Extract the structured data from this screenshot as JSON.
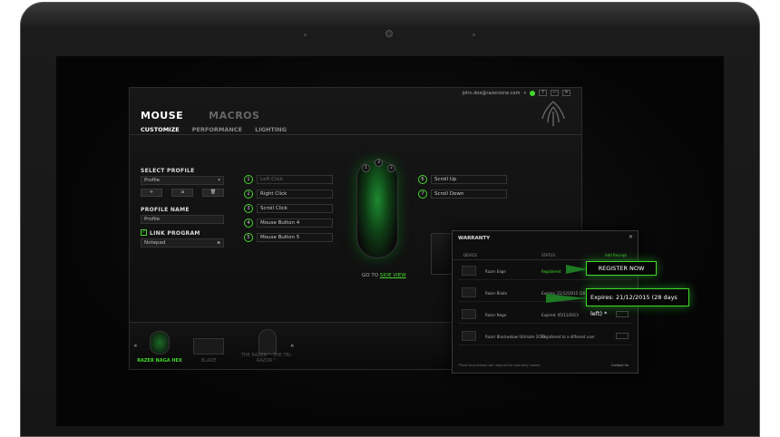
{
  "app": {
    "user": "john.doe@razerzone.com",
    "window_buttons": [
      "?",
      "—",
      "✕"
    ],
    "nav_main": [
      "MOUSE",
      "MACROS"
    ],
    "nav_sub": [
      "CUSTOMIZE",
      "PERFORMANCE",
      "LIGHTING"
    ]
  },
  "profile": {
    "select_label": "SELECT PROFILE",
    "selected": "Profile",
    "buttons": [
      "+",
      "⇲",
      "🗑"
    ],
    "name_label": "PROFILE NAME",
    "name_value": "Profile",
    "link_label": "LINK PROGRAM",
    "link_value": "Notepad"
  },
  "buttons_left": [
    {
      "num": "1",
      "label": "Left Click"
    },
    {
      "num": "2",
      "label": "Right Click"
    },
    {
      "num": "3",
      "label": "Scroll Click"
    },
    {
      "num": "4",
      "label": "Mouse Button 4"
    },
    {
      "num": "5",
      "label": "Mouse Button 5"
    }
  ],
  "buttons_right": [
    {
      "num": "6",
      "label": "Scroll Up"
    },
    {
      "num": "7",
      "label": "Scroll Down"
    }
  ],
  "goto": {
    "prefix": "GO TO",
    "link": "SIDE VIEW"
  },
  "devices": [
    {
      "name": "RAZER NAGA HEX"
    },
    {
      "name": "BLADE"
    },
    {
      "name": "THE RAZER™ THE TRI-RAZOR™"
    }
  ],
  "warranty": {
    "title": "WARRANTY",
    "close": "✕",
    "col_device": "DEVICE",
    "col_status": "STATUS",
    "col_register": "Add Receipt",
    "rows": [
      {
        "device": "Razer Edge",
        "status": "Registered"
      },
      {
        "device": "Razer Blade",
        "status": "Expires: 21/12/2015 (28 days left)"
      },
      {
        "device": "Razer Naga",
        "status": "Expired: 05/11/2013"
      },
      {
        "device": "Razer Blackwidow Ultimate 2013",
        "status": "Registered to a different user"
      }
    ],
    "footnote": "*Proof of purchase will required for warranty claims.",
    "contact": "Contact Us"
  },
  "callouts": {
    "register": "REGISTER NOW",
    "expires": "Expires: 21/12/2015 (28 days left) *"
  },
  "colors": {
    "accent": "#44d62c",
    "background": "#0b0b0b",
    "bezel": "#1b1b1b"
  }
}
